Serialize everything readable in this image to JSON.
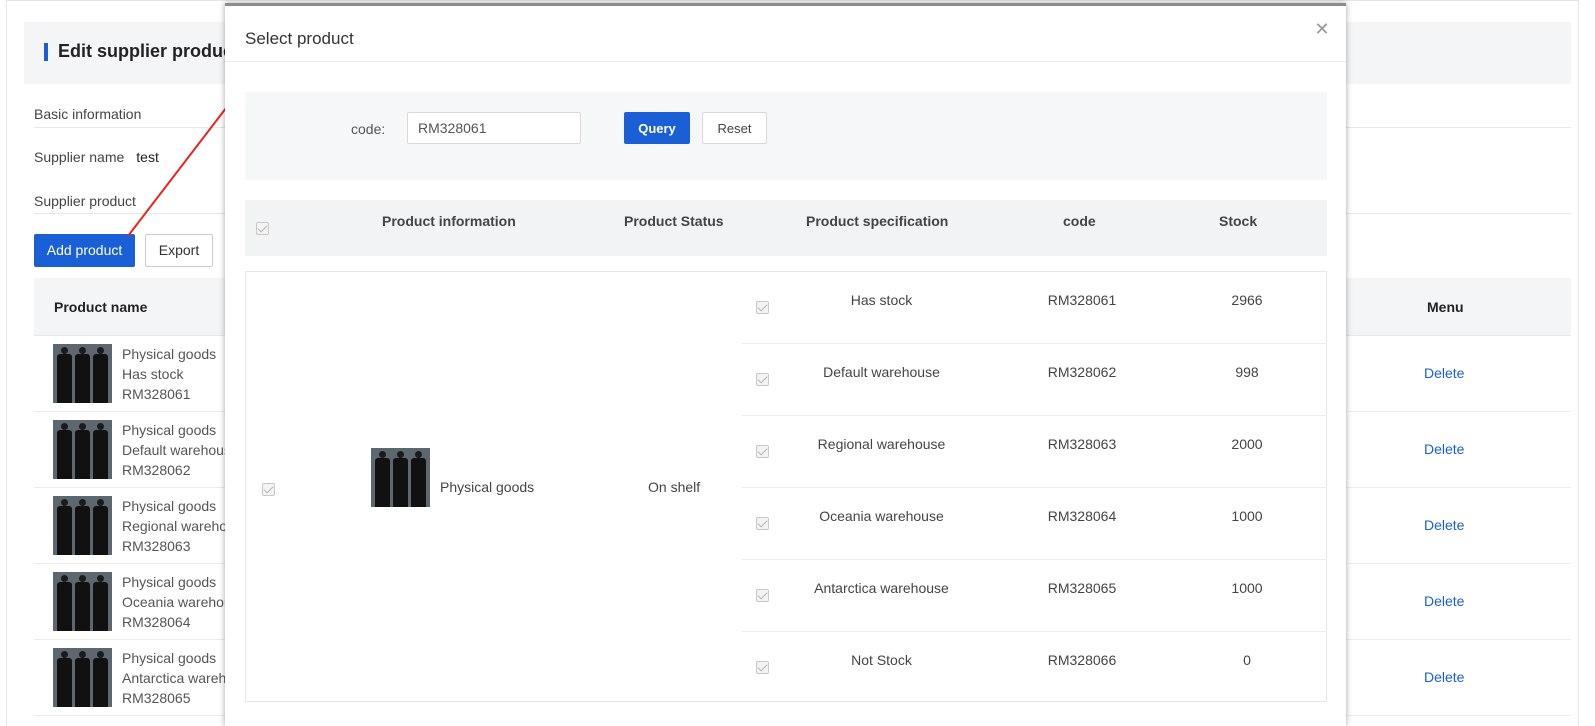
{
  "page": {
    "title": "Edit supplier product",
    "sections": {
      "basic_info": "Basic information",
      "supplier_name_label": "Supplier name",
      "supplier_name_value": "test",
      "supplier_product": "Supplier product"
    },
    "buttons": {
      "add_product": "Add product",
      "export": "Export"
    },
    "table": {
      "headers": {
        "product_name": "Product name",
        "menu": "Menu"
      },
      "rows": [
        {
          "type": "Physical goods",
          "spec": "Has stock",
          "code": "RM328061",
          "action": "Delete"
        },
        {
          "type": "Physical goods",
          "spec": "Default warehouse",
          "code": "RM328062",
          "action": "Delete"
        },
        {
          "type": "Physical goods",
          "spec": "Regional warehouse",
          "code": "RM328063",
          "action": "Delete"
        },
        {
          "type": "Physical goods",
          "spec": "Oceania warehouse",
          "code": "RM328064",
          "action": "Delete"
        },
        {
          "type": "Physical goods",
          "spec": "Antarctica warehouse",
          "code": "RM328065",
          "action": "Delete"
        }
      ]
    }
  },
  "modal": {
    "title": "Select product",
    "close_icon": "close-icon",
    "query": {
      "code_label": "code:",
      "code_value": "RM328061",
      "query_button": "Query",
      "reset_button": "Reset"
    },
    "table": {
      "headers": {
        "product_information": "Product information",
        "product_status": "Product Status",
        "product_specification": "Product specification",
        "code": "code",
        "stock": "Stock"
      },
      "product": {
        "name": "Physical goods",
        "status": "On shelf"
      },
      "skus": [
        {
          "spec": "Has stock",
          "code": "RM328061",
          "stock": "2966"
        },
        {
          "spec": "Default warehouse",
          "code": "RM328062",
          "stock": "998"
        },
        {
          "spec": "Regional warehouse",
          "code": "RM328063",
          "stock": "2000"
        },
        {
          "spec": "Oceania warehouse",
          "code": "RM328064",
          "stock": "1000"
        },
        {
          "spec": "Antarctica warehouse",
          "code": "RM328065",
          "stock": "1000"
        },
        {
          "spec": "Not Stock",
          "code": "RM328066",
          "stock": "0"
        }
      ]
    }
  },
  "colors": {
    "accent": "#1a5fd6",
    "annotation_arrow": "#e8261b"
  }
}
